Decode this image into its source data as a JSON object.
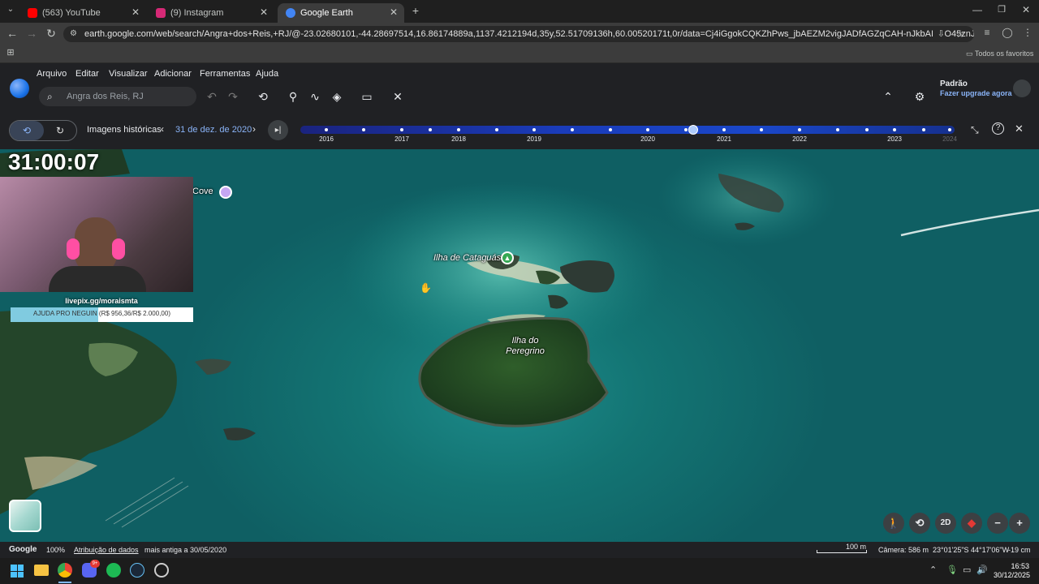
{
  "browser": {
    "tabs": [
      {
        "label": "(563) YouTube",
        "color": "#ff0000"
      },
      {
        "label": "(9) Instagram",
        "color": "#d62976"
      },
      {
        "label": "Google Earth",
        "color": "#4285f4"
      }
    ],
    "url": "earth.google.com/web/search/Angra+dos+Reis,+RJ/@-23.02680101,-44.28697514,16.86174889a,1137.4212194d,35y,52.51709136h,60.00520171t,0r/data=Cj4iGgokCQKZhPws_jbAEZM2vigJADfAGZqCAH-nJkbAIUyO45znJ0bAKhAIARIKMjAyMC0xMi0zMR...",
    "bookmarks_label": "Todos os favoritos"
  },
  "earth": {
    "menu": [
      "Arquivo",
      "Editar",
      "Visualizar",
      "Adicionar",
      "Ferramentas",
      "Ajuda"
    ],
    "search_placeholder": "Angra dos Reis, RJ",
    "profile_title": "Padrão",
    "profile_sub": "Fazer upgrade agora",
    "history_label": "Imagens históricas",
    "history_date": "31 de dez. de 2020",
    "years": [
      "2016",
      "2017",
      "2018",
      "2019",
      "2020",
      "2021",
      "2022",
      "2023",
      "2024"
    ],
    "selected_year_fraction": 0.6,
    "map_labels": {
      "cove": "Cove",
      "cataguas": "Ilha de Cataguás",
      "peregrino_1": "Ilha do",
      "peregrino_2": "Peregrino"
    },
    "controls": {
      "mode_2d": "2D",
      "zoom_out": "−",
      "zoom_in": "+"
    },
    "bottom": {
      "google": "Google",
      "zoom": "100%",
      "attribution": "Atribuição de dados",
      "oldest": "mais antiga a 30/05/2020",
      "scale": "100 m",
      "camera": "Câmera: 586 m",
      "coords": "23°01'25\"S 44°17'06\"W",
      "elev": "-19 cm"
    }
  },
  "overlay": {
    "timer": "31:00:07",
    "livepix": "livepix.gg/moraismta",
    "goal_text": "AJUDA PRO NEGUIN (R$ 956,36/R$ 2.000,00)",
    "goal_fraction": 0.48
  },
  "taskbar": {
    "time": "16:53",
    "date": "30/12/2025",
    "badge": "9+"
  }
}
